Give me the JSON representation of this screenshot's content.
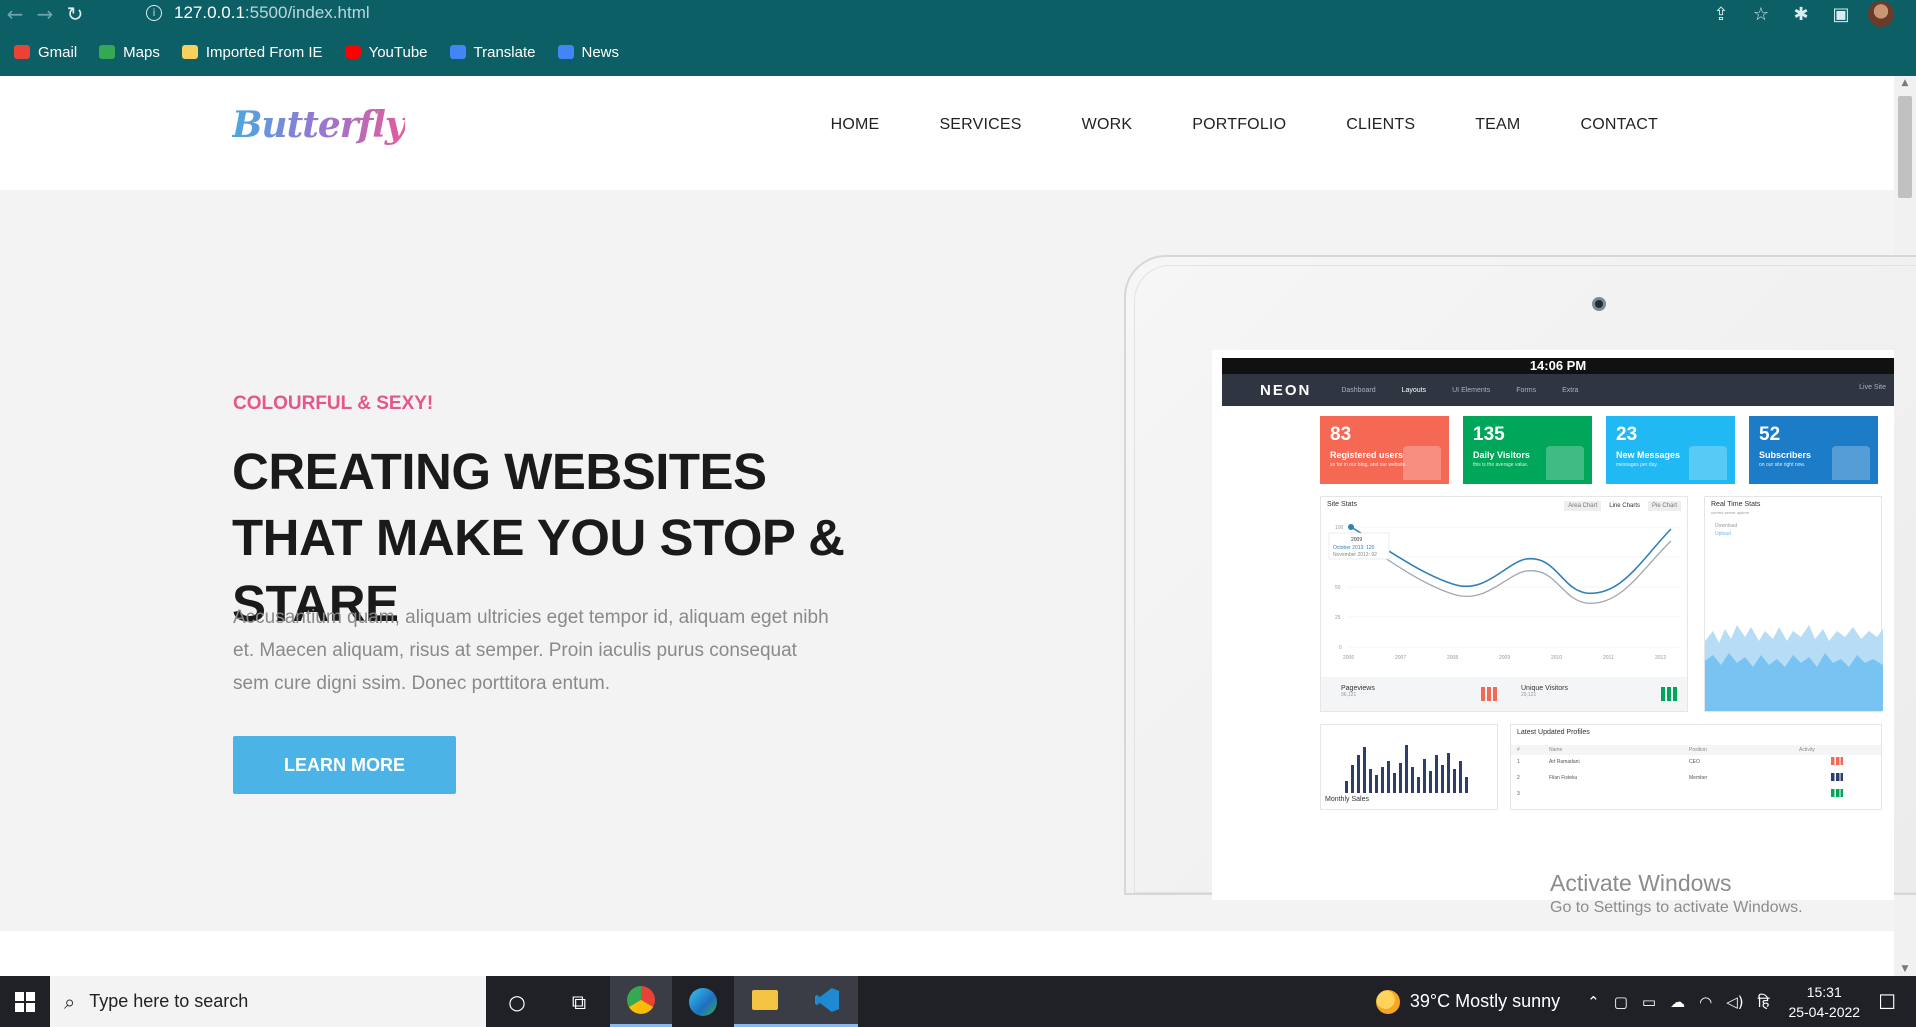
{
  "browser": {
    "url_host": "127.0.0.1",
    "url_path": ":5500/index.html",
    "bookmarks": [
      {
        "label": "Gmail",
        "color": "#ea4335"
      },
      {
        "label": "Maps",
        "color": "#34a853"
      },
      {
        "label": "Imported From IE",
        "color": "#f6d15b"
      },
      {
        "label": "YouTube",
        "color": "#ff0000"
      },
      {
        "label": "Translate",
        "color": "#4285f4"
      },
      {
        "label": "News",
        "color": "#4285f4"
      }
    ]
  },
  "site": {
    "logo": "Butterfly",
    "menu": [
      "HOME",
      "SERVICES",
      "WORK",
      "PORTFOLIO",
      "CLIENTS",
      "TEAM",
      "CONTACT"
    ],
    "hero": {
      "tagline": "COLOURFUL & SEXY!",
      "headline": "CREATING WEBSITES THAT MAKE YOU STOP & STARE",
      "lead": "Accusantium quam, aliquam ultricies eget tempor id, aliquam eget nibh et. Maecen aliquam, risus at semper. Proin iaculis purus consequat sem cure digni ssim. Donec porttitora entum.",
      "button": "LEARN MORE"
    },
    "colors": {
      "accent_pink": "#e4568c",
      "button_blue": "#4bb3e6",
      "hero_bg": "#f3f3f3"
    }
  },
  "mockup": {
    "clock": "14:06 PM",
    "brand": "NEON",
    "nav": [
      "Dashboard",
      "Layouts",
      "UI Elements",
      "Forms",
      "Extra"
    ],
    "nav_right": "Live Site",
    "tiles": [
      {
        "num": "83",
        "label": "Registered users",
        "sub": "so far in our blog, and our website.",
        "color": "#f56954"
      },
      {
        "num": "135",
        "label": "Daily Visitors",
        "sub": "this is the average value.",
        "color": "#00a65a"
      },
      {
        "num": "23",
        "label": "New Messages",
        "sub": "messages per day.",
        "color": "#21b9f3"
      },
      {
        "num": "52",
        "label": "Subscribers",
        "sub": "on our site right now.",
        "color": "#1c7cc8"
      }
    ],
    "site_stats": {
      "title": "Site Stats",
      "tabs": [
        "Area Chart",
        "Line Charts",
        "Pie Chart"
      ],
      "tooltip_title": "2009",
      "tooltip_line1": "October 2013: 120",
      "tooltip_line2": "November 2013: 92",
      "years": [
        "2006",
        "2007",
        "2008",
        "2009",
        "2010",
        "2011",
        "2012"
      ],
      "yticks": [
        "100",
        "75",
        "50",
        "25",
        "0"
      ],
      "footer_left": "Pageviews",
      "footer_left_sub": "96,121",
      "footer_right": "Unique Visitors",
      "footer_right_sub": "29,121"
    },
    "real_time": {
      "title": "Real Time Stats",
      "sub": "current server uptime",
      "legend1": "Download",
      "legend2": "Upload"
    },
    "monthly": {
      "title": "Monthly Sales"
    },
    "profiles": {
      "title": "Latest Updated Profiles",
      "cols": [
        "#",
        "Name",
        "Position",
        "Activity"
      ],
      "rows": [
        {
          "n": "1",
          "name": "Art Ramadani",
          "pos": "CEO"
        },
        {
          "n": "2",
          "name": "Filan Fisteku",
          "pos": "Member"
        },
        {
          "n": "3",
          "name": "",
          "pos": ""
        }
      ]
    }
  },
  "watermark": {
    "line1": "Activate Windows",
    "line2": "Go to Settings to activate Windows."
  },
  "taskbar": {
    "search_placeholder": "Type here to search",
    "weather": "39°C  Mostly sunny",
    "time": "15:31",
    "date": "25-04-2022",
    "lang_glyph": "हि"
  }
}
